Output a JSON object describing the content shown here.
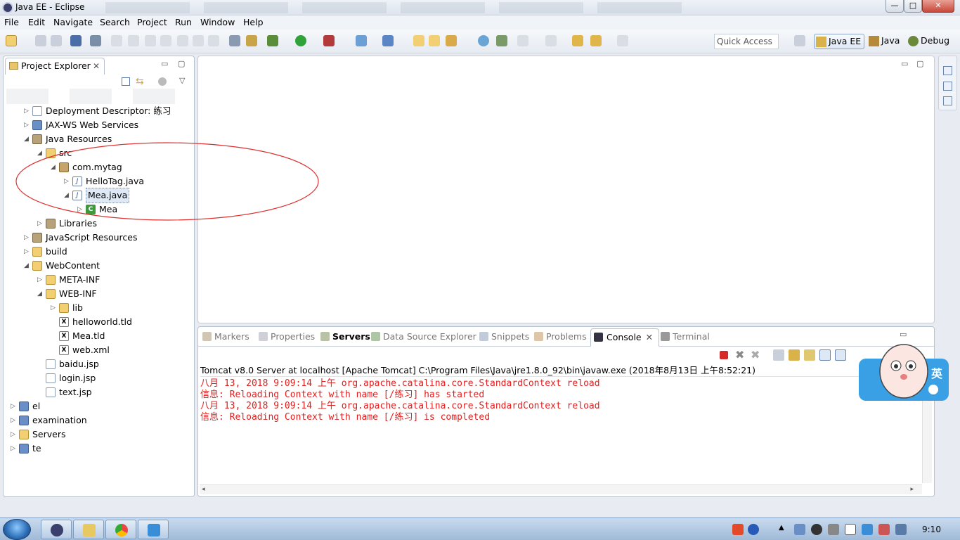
{
  "window": {
    "title": "Java EE - Eclipse",
    "controls": {
      "minimize": "—",
      "maximize": "□",
      "close": "✕"
    }
  },
  "menu": [
    "File",
    "Edit",
    "Navigate",
    "Search",
    "Project",
    "Run",
    "Window",
    "Help"
  ],
  "toolbar": {
    "quick_access_placeholder": "Quick Access",
    "perspectives": [
      "Java EE",
      "Java",
      "Debug"
    ]
  },
  "explorer": {
    "tab_title": "Project Explorer",
    "tab_close": "✕",
    "tree": [
      {
        "label": "Deployment Descriptor: 练习",
        "arrow": "▷",
        "icon": "deployment-descriptor-icon"
      },
      {
        "label": "JAX-WS Web Services",
        "arrow": "▷",
        "icon": "web-services-icon"
      },
      {
        "label": "Java Resources",
        "arrow": "◢",
        "icon": "java-resources-icon"
      },
      {
        "label": "src",
        "arrow": "◢",
        "icon": "source-folder-icon"
      },
      {
        "label": "com.mytag",
        "arrow": "◢",
        "icon": "package-icon"
      },
      {
        "label": "HelloTag.java",
        "arrow": "▷",
        "icon": "java-file-icon"
      },
      {
        "label": "Mea.java",
        "arrow": "◢",
        "icon": "java-file-icon"
      },
      {
        "label": "Mea",
        "arrow": "▷",
        "icon": "class-icon"
      },
      {
        "label": "Libraries",
        "arrow": "▷",
        "icon": "libraries-icon"
      },
      {
        "label": "JavaScript Resources",
        "arrow": "▷",
        "icon": "javascript-resources-icon"
      },
      {
        "label": "build",
        "arrow": "▷",
        "icon": "folder-icon"
      },
      {
        "label": "WebContent",
        "arrow": "◢",
        "icon": "folder-icon"
      },
      {
        "label": "META-INF",
        "arrow": "▷",
        "icon": "folder-icon"
      },
      {
        "label": "WEB-INF",
        "arrow": "◢",
        "icon": "folder-icon"
      },
      {
        "label": "lib",
        "arrow": "▷",
        "icon": "folder-icon"
      },
      {
        "label": "helloworld.tld",
        "arrow": "",
        "icon": "xml-file-icon"
      },
      {
        "label": "Mea.tld",
        "arrow": "",
        "icon": "xml-file-icon"
      },
      {
        "label": "web.xml",
        "arrow": "",
        "icon": "xml-file-icon"
      },
      {
        "label": "baidu.jsp",
        "arrow": "",
        "icon": "jsp-file-icon"
      },
      {
        "label": "login.jsp",
        "arrow": "",
        "icon": "jsp-file-icon"
      },
      {
        "label": "text.jsp",
        "arrow": "",
        "icon": "jsp-file-icon"
      },
      {
        "label": "el",
        "arrow": "▷",
        "icon": "project-icon"
      },
      {
        "label": "examination",
        "arrow": "▷",
        "icon": "project-icon"
      },
      {
        "label": "Servers",
        "arrow": "▷",
        "icon": "folder-icon"
      },
      {
        "label": "te",
        "arrow": "▷",
        "icon": "project-icon"
      }
    ]
  },
  "bottom_panel": {
    "tabs": [
      "Markers",
      "Properties",
      "Servers",
      "Data Source Explorer",
      "Snippets",
      "Problems",
      "Console",
      "Terminal"
    ],
    "active_tab": "Console",
    "console_close": "✕",
    "console_title": "Tomcat v8.0 Server at localhost [Apache Tomcat] C:\\Program Files\\Java\\jre1.8.0_92\\bin\\javaw.exe (2018年8月13日 上午8:52:21)",
    "console_lines": [
      "八月 13, 2018 9:09:14 上午 org.apache.catalina.core.StandardContext reload",
      "信息: Reloading Context with name [/练习] has started",
      "八月 13, 2018 9:09:14 上午 org.apache.catalina.core.StandardContext reload",
      "信息: Reloading Context with name [/练习] is completed"
    ]
  },
  "sticker": {
    "text": "英"
  },
  "taskbar": {
    "clock": "9:10"
  },
  "colors": {
    "console_text": "#e02020",
    "annotation": "#e03030",
    "selection": "#dfe9f6"
  }
}
